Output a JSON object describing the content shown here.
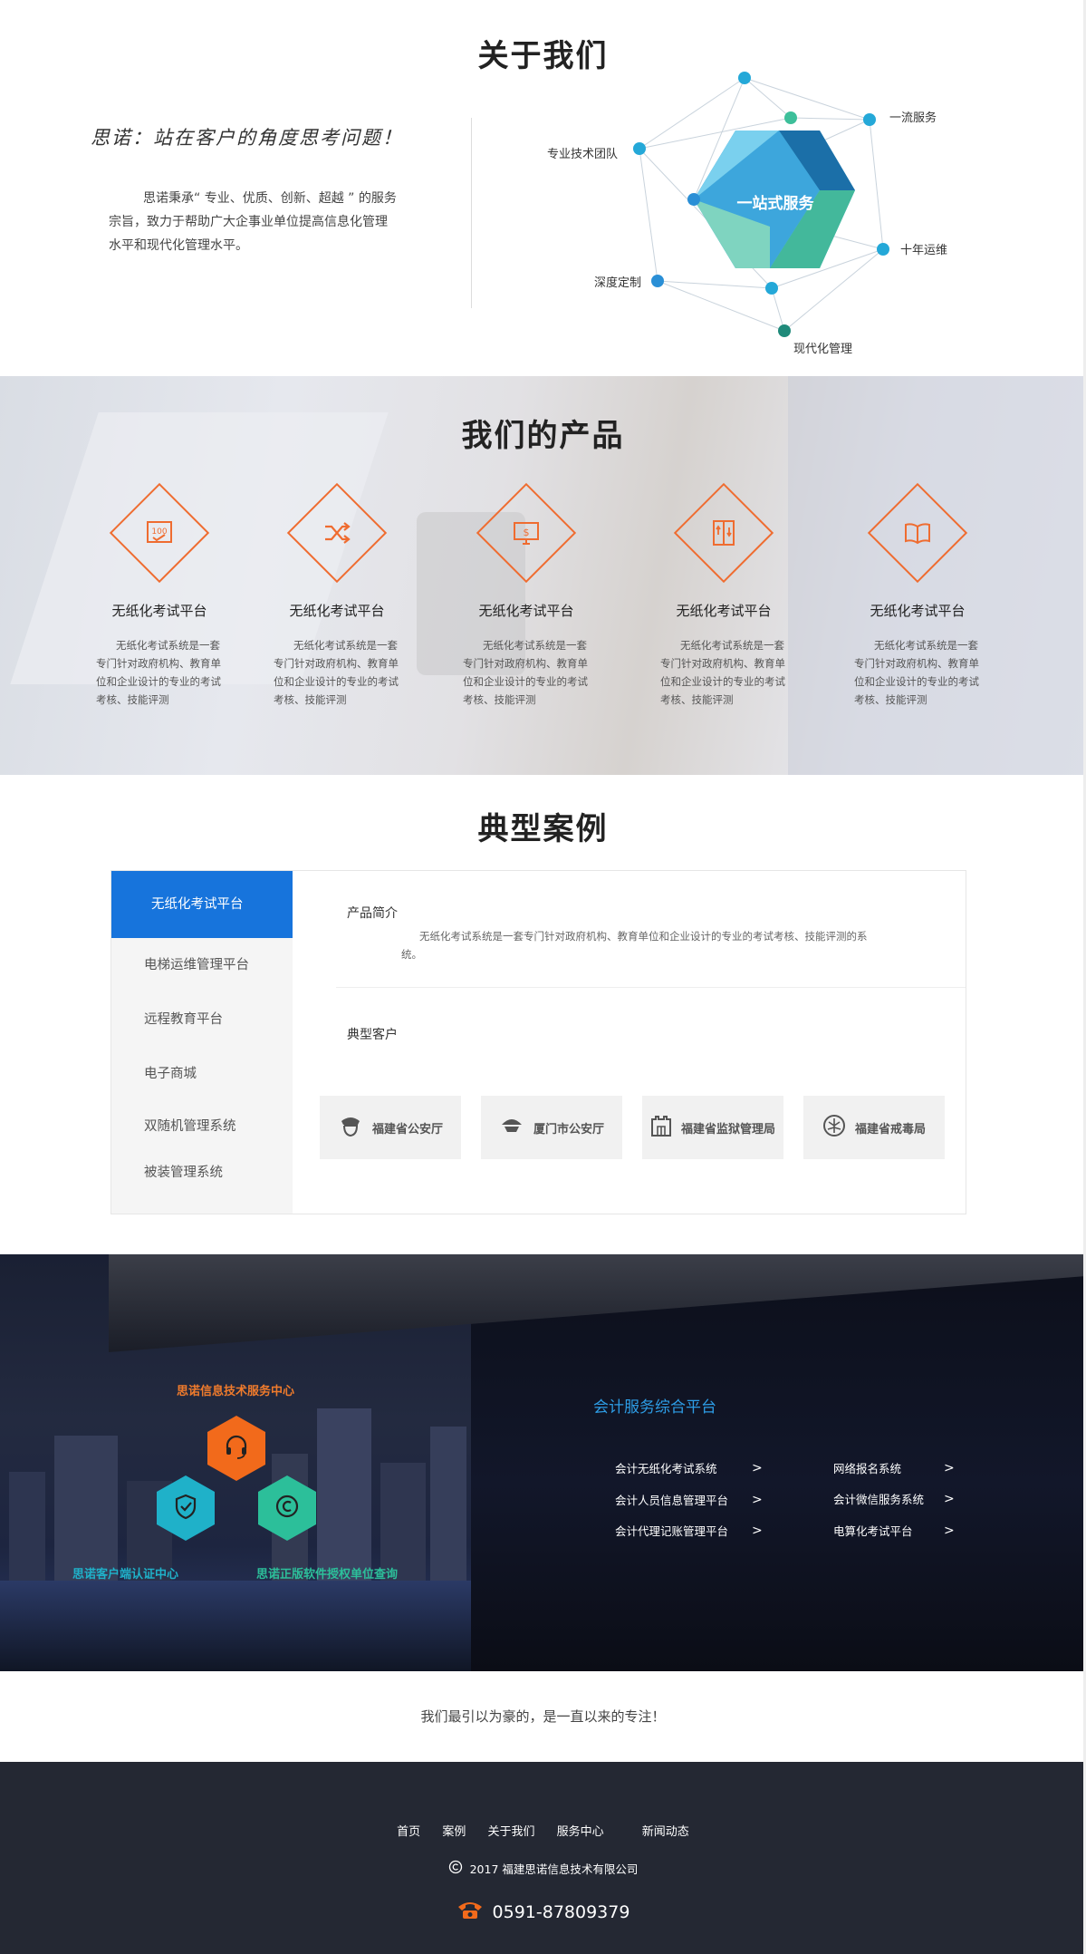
{
  "about": {
    "title": "关于我们",
    "slogan": "思诺：站在客户的角度思考问题！",
    "text": "思诺秉承“ 专业、优质、创新、超越 ” 的服务宗旨，致力于帮助广大企事业单位提高信息化管理水平和现代化管理水平。",
    "diagram": {
      "center": "一站式服务",
      "labels": {
        "top_right": "一流服务",
        "left": "专业技术团队",
        "right": "十年运维",
        "bottom_left": "深度定制",
        "bottom": "现代化管理"
      }
    }
  },
  "products": {
    "title": "我们的产品",
    "items": [
      {
        "icon": "score-100-icon",
        "name": "无纸化考试平台",
        "desc": "无纸化考试系统是一套专门针对政府机构、教育单位和企业设计的专业的考试考核、技能评测"
      },
      {
        "icon": "shuffle-icon",
        "name": "无纸化考试平台",
        "desc": "无纸化考试系统是一套专门针对政府机构、教育单位和企业设计的专业的考试考核、技能评测"
      },
      {
        "icon": "monitor-dollar-icon",
        "name": "无纸化考试平台",
        "desc": "无纸化考试系统是一套专门针对政府机构、教育单位和企业设计的专业的考试考核、技能评测"
      },
      {
        "icon": "elevator-icon",
        "name": "无纸化考试平台",
        "desc": "无纸化考试系统是一套专门针对政府机构、教育单位和企业设计的专业的考试考核、技能评测"
      },
      {
        "icon": "open-book-icon",
        "name": "无纸化考试平台",
        "desc": "无纸化考试系统是一套专门针对政府机构、教育单位和企业设计的专业的考试考核、技能评测"
      }
    ],
    "accent": "#ef6c30"
  },
  "cases": {
    "title": "典型案例",
    "tabs": [
      "无纸化考试平台",
      "电梯运维管理平台",
      "远程教育平台",
      "电子商城",
      "双随机管理系统",
      "被装管理系统"
    ],
    "active_tab": 0,
    "intro_title": "产品简介",
    "intro_text": "无纸化考试系统是一套专门针对政府机构、教育单位和企业设计的专业的考试考核、技能评测的系统。",
    "clients_title": "典型客户",
    "clients": [
      {
        "icon": "police-cap-icon",
        "name": "福建省公安厅"
      },
      {
        "icon": "police-badge-icon",
        "name": "厦门市公安厅"
      },
      {
        "icon": "prison-gate-icon",
        "name": "福建省监狱管理局"
      },
      {
        "icon": "anti-drug-icon",
        "name": "福建省戒毒局"
      }
    ],
    "accent": "#1774dc"
  },
  "services": {
    "center_title": "思诺信息技术服务中心",
    "hexes": [
      {
        "icon": "headset-icon",
        "label": "",
        "color": "#f26a1b"
      },
      {
        "icon": "shield-check-icon",
        "label": "思诺客户端认证中心",
        "color": "#1fb1c9"
      },
      {
        "icon": "copyright-icon",
        "label": "思诺正版软件授权单位查询",
        "color": "#2cbf9a"
      }
    ],
    "platform_title": "会计服务综合平台",
    "links_left": [
      "会计无纸化考试系统",
      "会计人员信息管理平台",
      "会计代理记账管理平台"
    ],
    "links_right": [
      "网络报名系统",
      "会计微信服务系统",
      "电算化考试平台"
    ],
    "arrow": ">"
  },
  "tagline": "我们最引以为豪的，是一直以来的专注！",
  "footer": {
    "nav": [
      "首页",
      "案例",
      "关于我们",
      "服务中心",
      "新闻动态"
    ],
    "copyright": "2017 福建思诺信息技术有限公司",
    "phone": "0591-87809379"
  }
}
